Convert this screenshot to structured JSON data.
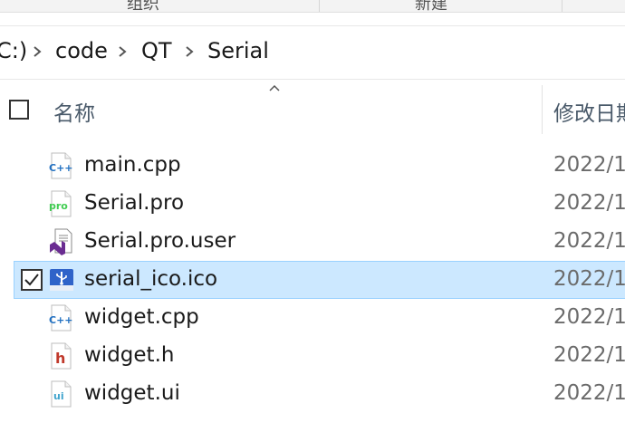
{
  "ribbon": {
    "groups": [
      "组织",
      "新建"
    ]
  },
  "breadcrumb": {
    "items": [
      "C:)",
      "code",
      "QT",
      "Serial"
    ]
  },
  "header": {
    "name_label": "名称",
    "date_label": "修改日期"
  },
  "files": [
    {
      "name": "main.cpp",
      "date": "2022/1",
      "icon": "cpp-file-icon",
      "selected": false
    },
    {
      "name": "Serial.pro",
      "date": "2022/1",
      "icon": "pro-file-icon",
      "selected": false
    },
    {
      "name": "Serial.pro.user",
      "date": "2022/1",
      "icon": "visual-studio-user-file-icon",
      "selected": false
    },
    {
      "name": "serial_ico.ico",
      "date": "2022/1",
      "icon": "usb-ico-file-icon",
      "selected": true
    },
    {
      "name": "widget.cpp",
      "date": "2022/1",
      "icon": "cpp-file-icon",
      "selected": false
    },
    {
      "name": "widget.h",
      "date": "2022/1",
      "icon": "header-file-icon",
      "selected": false
    },
    {
      "name": "widget.ui",
      "date": "2022/1",
      "icon": "ui-file-icon",
      "selected": false
    }
  ],
  "colors": {
    "selection_bg": "#cce8ff",
    "selection_border": "#99d1ff",
    "cpp_blue": "#1f6fc1",
    "pro_green": "#41cd52",
    "header_red": "#c0392b",
    "vs_purple": "#6a2c91"
  }
}
